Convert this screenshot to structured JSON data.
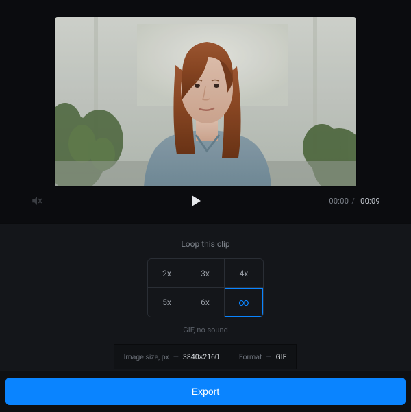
{
  "player": {
    "current_time": "00:00",
    "total_time": "00:09",
    "muted": true
  },
  "loop": {
    "title": "Loop this clip",
    "options": [
      "2x",
      "3x",
      "4x",
      "5x",
      "6x",
      "∞"
    ],
    "selected_index": 5,
    "note": "GIF, no sound"
  },
  "info": {
    "size_label": "Image size, px",
    "size_value": "3840×2160",
    "format_label": "Format",
    "format_value": "GIF"
  },
  "export_label": "Export",
  "colors": {
    "accent": "#0a84ff",
    "bg": "#0e0f12"
  }
}
